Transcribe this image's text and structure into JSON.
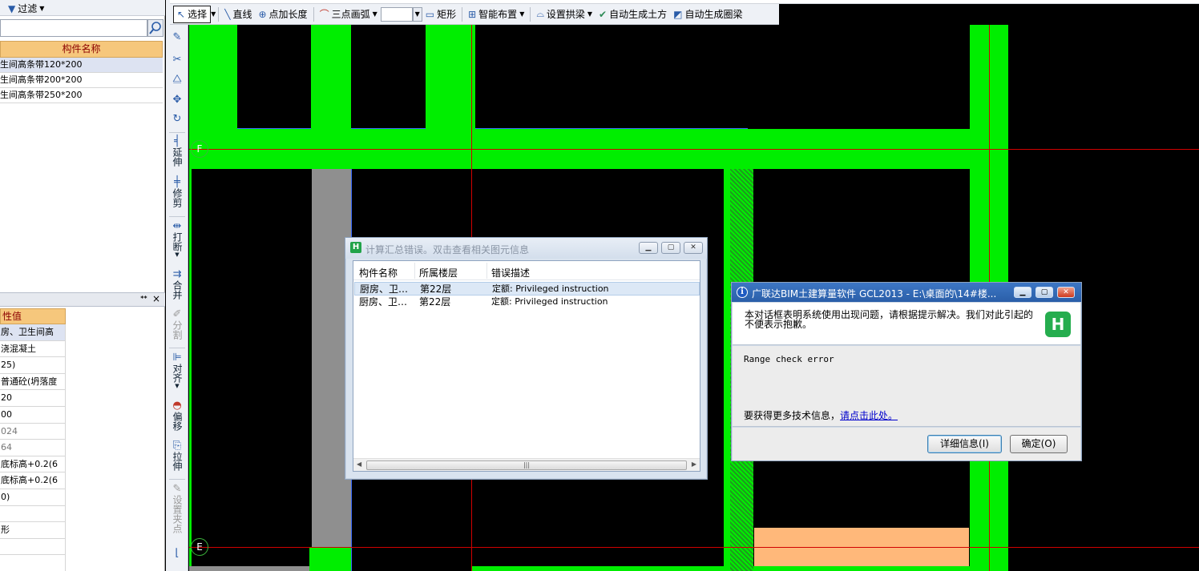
{
  "left_panel": {
    "filter_label": "过滤",
    "component_header": "构件名称",
    "components": [
      "生间高条带120*200",
      "生间高条带200*200",
      "生间高条带250*200"
    ],
    "property_header": "性值",
    "properties": [
      "房、卫生间高",
      "浇混凝土",
      "25)",
      "普通砼(坍落度",
      "20",
      "00",
      "024",
      "64",
      "底标高+0.2(6",
      "底标高+0.2(6",
      "0)",
      "",
      "形"
    ]
  },
  "vertical_toolbar": {
    "items": [
      {
        "label": "延伸",
        "icon": "extend-icon"
      },
      {
        "label": "修剪",
        "icon": "trim-icon"
      },
      {
        "label": "打断",
        "icon": "break-icon"
      },
      {
        "label": "合并",
        "icon": "merge-icon"
      },
      {
        "label": "分割",
        "icon": "split-icon"
      },
      {
        "label": "对齐",
        "icon": "align-icon"
      },
      {
        "label": "偏移",
        "icon": "offset-icon"
      },
      {
        "label": "拉伸",
        "icon": "stretch-icon"
      },
      {
        "label": "设置夹点",
        "icon": "grip-icon"
      }
    ]
  },
  "toolbar": {
    "select": "选择",
    "line": "直线",
    "point_length": "点加长度",
    "three_point_arc": "三点画弧",
    "rect": "矩形",
    "smart_layout": "智能布置",
    "set_arch_beam": "设置拱梁",
    "auto_earthwork": "自动生成土方",
    "auto_ring_beam": "自动生成圈梁"
  },
  "canvas": {
    "axis_labels": [
      "F",
      "E"
    ],
    "colors": {
      "wall": "#00ee00",
      "grid": "#d10000",
      "slab": "#ffb87a",
      "beam": "#8f8f8f"
    }
  },
  "error_dialog": {
    "title": "计算汇总错误。双击查看相关图元信息",
    "columns": [
      "构件名称",
      "所属楼层",
      "错误描述"
    ],
    "rows": [
      {
        "name": "厨房、卫…",
        "floor": "第22层",
        "desc": "定额: Privileged instruction"
      },
      {
        "name": "厨房、卫…",
        "floor": "第22层",
        "desc": "定额: Privileged instruction"
      }
    ]
  },
  "system_dialog": {
    "title": "广联达BIM土建算量软件 GCL2013 - E:\\桌面的\\14#楼...",
    "message": "本对话框表明系统使用出现问题，请根据提示解决。我们对此引起的不便表示抱歉。",
    "error_text": "Range check error",
    "more_info_prefix": "要获得更多技术信息，",
    "more_info_link": "请点击此处。",
    "details_button": "详细信息(I)",
    "ok_button": "确定(O)"
  }
}
